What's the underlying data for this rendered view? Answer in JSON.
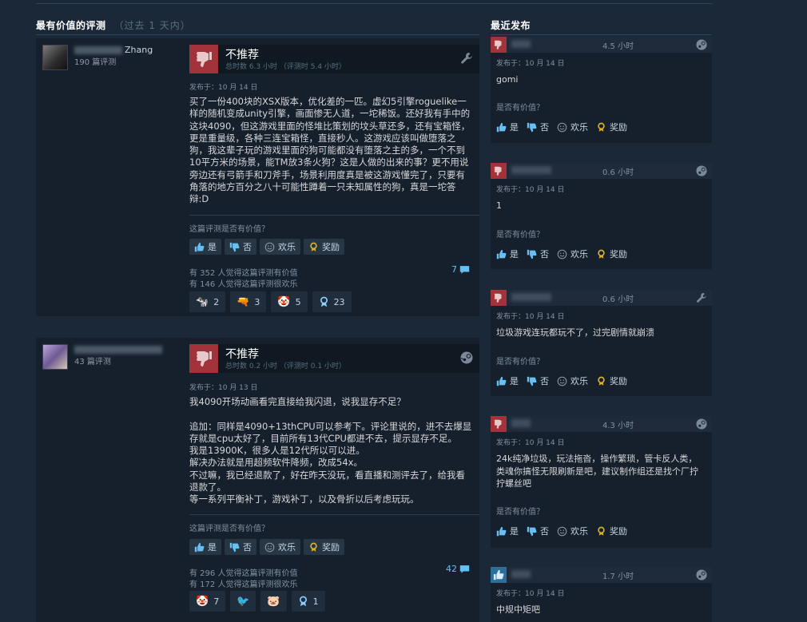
{
  "left_section": {
    "title": "最有价值的评测",
    "subtitle": "（过去 1 天内）"
  },
  "right_section": {
    "title": "最近发布"
  },
  "vote_labels": {
    "yes": "是",
    "no": "否",
    "funny": "欢乐",
    "award": "奖励"
  },
  "reviews": [
    {
      "user_name": "Zhang",
      "review_count": "190 篇评测",
      "verdict": "不推荐",
      "hours": "总时数 6.3 小时  （评测时 5.4 小时）",
      "posted": "发布于：10 月 14 日",
      "text": "买了一份400块的XSX版本，优化差的一匹。虚幻5引擎roguelike一样的随机变成unity引擎，画面惨无人道，一坨稀饭。还好我有手中的这块4090，但这游戏里面的怪堆比策划的坟头草还多，还有宝箱怪，更是重量级，各种三连宝箱怪，直接秒人。这游戏应该叫做堕落之狗，我这辈子玩的游戏里面的狗可能都没有堕落之主的多，一个不到10平方米的场景，能TM放3条火狗？这是人做的出来的事？更不用说旁边还有弓箭手和刀斧手，场景利用度真是被这游戏懂完了，只要有角落的地方百分之八十可能性蹲着一只未知属性的狗，真是一坨答辩:D",
      "helpful_q": "这篇评测是否有价值？",
      "stat_helpful": "有 352 人觉得这篇评测有价值",
      "stat_funny": "有 146 人觉得这篇评测很欢乐",
      "comments": "7",
      "awards": [
        "2",
        "3",
        "5",
        "23"
      ]
    },
    {
      "user_name": "",
      "review_count": "43 篇评测",
      "verdict": "不推荐",
      "hours": "总时数 0.2 小时  （评测时 0.1 小时）",
      "posted": "发布于：10 月 13 日",
      "text": "我4090开场动画看完直接给我闪退，说我显存不足？\n\n追加：同样是4090+13thCPU可以参考下。评论里说的，进不去爆显存就是cpu太好了，目前所有13代CPU都进不去，提示显存不足。\n我是13900K，很多人是12代所以可以进。\n解决办法就是用超频软件降频，改成54x。\n不过嘛，我已经退款了，好在昨天没玩，看直播和测评去了，给我看退款了。\n等一系列平衡补丁，游戏补丁，以及骨折以后考虑玩玩。",
      "helpful_q": "这篇评测是否有价值？",
      "stat_helpful": "有 296 人觉得这篇评测有价值",
      "stat_funny": "有 172 人觉得这篇评测很欢乐",
      "comments": "42",
      "awards": [
        "7",
        "",
        "",
        "1"
      ]
    }
  ],
  "recent": [
    {
      "hours": "4.5 小时",
      "posted": "发布于：10 月 14 日",
      "text": "gomi",
      "question": "是否有价值？",
      "positive": false
    },
    {
      "hours": "0.6 小时",
      "posted": "发布于：10 月 14 日",
      "text": "1",
      "question": "是否有价值？",
      "positive": false
    },
    {
      "hours": "0.6 小时",
      "posted": "发布于：10 月 14 日",
      "text": "垃圾游戏连玩都玩不了，过完剧情就崩溃",
      "question": "是否有价值？",
      "positive": false
    },
    {
      "hours": "4.3 小时",
      "posted": "发布于：10 月 14 日",
      "text": "24k纯净垃圾，玩法拖沓，操作繁琐，管卡反人类，类魂你搞怪无限刷新是吧，建议制作组还是找个厂拧拧螺丝吧",
      "question": "是否有价值？",
      "positive": false
    },
    {
      "hours": "1.7 小时",
      "posted": "发布于：10 月 14 日",
      "text": "中规中矩吧",
      "question": "",
      "positive": true
    }
  ],
  "colors": {
    "background": "#1b2838",
    "thumb_down": "#a3333a",
    "thumb_up": "#2f6e9b",
    "link": "#66c0f4"
  }
}
